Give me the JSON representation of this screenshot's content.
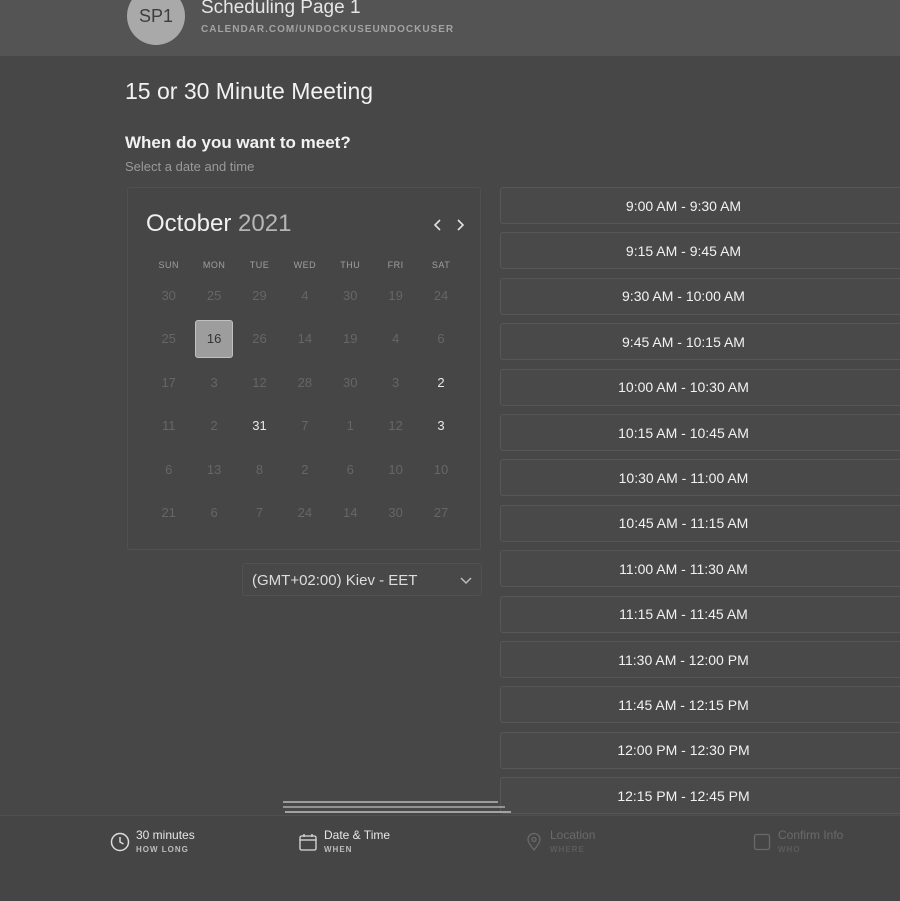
{
  "header": {
    "avatar_initials": "SP1",
    "page_name": "Scheduling Page 1",
    "page_url": "CALENDAR.COM/UNDOCKUSEUNDOCKUSER"
  },
  "event": {
    "title": "15 or 30 Minute Meeting",
    "question": "When do you want to meet?",
    "question_sub": "Select a date and time"
  },
  "calendar": {
    "month": "October",
    "year": "2021",
    "prev_icon": "chevron-left-icon",
    "next_icon": "chevron-right-icon",
    "weekdays": [
      "SUN",
      "MON",
      "TUE",
      "WED",
      "THU",
      "FRI",
      "SAT"
    ],
    "weeks": [
      [
        {
          "d": "30",
          "s": "muted"
        },
        {
          "d": "25",
          "s": "muted"
        },
        {
          "d": "29",
          "s": "muted"
        },
        {
          "d": "4",
          "s": "muted"
        },
        {
          "d": "30",
          "s": "muted"
        },
        {
          "d": "19",
          "s": "muted"
        },
        {
          "d": "24",
          "s": "muted"
        }
      ],
      [
        {
          "d": "25",
          "s": "muted"
        },
        {
          "d": "16",
          "s": "selected"
        },
        {
          "d": "26",
          "s": "muted"
        },
        {
          "d": "14",
          "s": "muted"
        },
        {
          "d": "19",
          "s": "muted"
        },
        {
          "d": "4",
          "s": "muted"
        },
        {
          "d": "6",
          "s": "muted"
        }
      ],
      [
        {
          "d": "17",
          "s": "muted"
        },
        {
          "d": "3",
          "s": "muted"
        },
        {
          "d": "12",
          "s": "muted"
        },
        {
          "d": "28",
          "s": "muted"
        },
        {
          "d": "30",
          "s": "muted"
        },
        {
          "d": "3",
          "s": "muted"
        },
        {
          "d": "2",
          "s": "available"
        }
      ],
      [
        {
          "d": "11",
          "s": "muted"
        },
        {
          "d": "2",
          "s": "muted"
        },
        {
          "d": "31",
          "s": "available"
        },
        {
          "d": "7",
          "s": "muted"
        },
        {
          "d": "1",
          "s": "muted"
        },
        {
          "d": "12",
          "s": "muted"
        },
        {
          "d": "3",
          "s": "available"
        }
      ],
      [
        {
          "d": "6",
          "s": "muted"
        },
        {
          "d": "13",
          "s": "muted"
        },
        {
          "d": "8",
          "s": "muted"
        },
        {
          "d": "2",
          "s": "muted"
        },
        {
          "d": "6",
          "s": "muted"
        },
        {
          "d": "10",
          "s": "muted"
        },
        {
          "d": "10",
          "s": "muted"
        }
      ],
      [
        {
          "d": "21",
          "s": "muted"
        },
        {
          "d": "6",
          "s": "muted"
        },
        {
          "d": "7",
          "s": "muted"
        },
        {
          "d": "24",
          "s": "muted"
        },
        {
          "d": "14",
          "s": "muted"
        },
        {
          "d": "30",
          "s": "muted"
        },
        {
          "d": "27",
          "s": "muted"
        }
      ]
    ]
  },
  "timezone": {
    "label": "(GMT+02:00) Kiev - EET",
    "icon": "chevron-down-icon"
  },
  "slots": [
    "9:00 AM - 9:30 AM",
    "9:15 AM - 9:45 AM",
    "9:30 AM - 10:00 AM",
    "9:45 AM - 10:15 AM",
    "10:00 AM - 10:30 AM",
    "10:15 AM - 10:45 AM",
    "10:30 AM - 11:00 AM",
    "10:45 AM - 11:15 AM",
    "11:00 AM - 11:30 AM",
    "11:15 AM - 11:45 AM",
    "11:30 AM - 12:00 PM",
    "11:45 AM - 12:15 PM",
    "12:00 PM - 12:30 PM",
    "12:15 PM - 12:45 PM"
  ],
  "footer": {
    "steps": [
      {
        "main": "30 minutes",
        "sub": "HOW LONG",
        "icon": "clock-icon",
        "state": "active"
      },
      {
        "main": "Date & Time",
        "sub": "WHEN",
        "icon": "calendar-icon",
        "state": "active"
      },
      {
        "main": "Location",
        "sub": "WHERE",
        "icon": "location-pin-icon",
        "state": "inactive"
      },
      {
        "main": "Confirm Info",
        "sub": "WHO",
        "icon": "checkbox-icon",
        "state": "inactive"
      }
    ]
  },
  "colors": {
    "background": "#474747",
    "header_bar": "#545454",
    "selected_day": "#9d9d9d",
    "text_primary": "#f2f2f2",
    "text_muted": "#666666"
  }
}
